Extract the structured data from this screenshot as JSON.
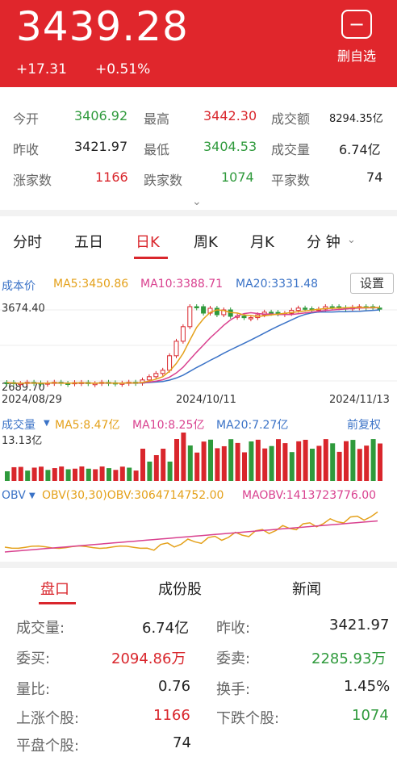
{
  "header": {
    "price": "3439.28",
    "change": "+17.31",
    "change_pct": "+0.51%",
    "remove_label": "删自选",
    "remove_icon_glyph": "−"
  },
  "stats": {
    "open_label": "今开",
    "open": "3406.92",
    "high_label": "最高",
    "high": "3442.30",
    "turnover_label": "成交额",
    "turnover": "8294.35亿",
    "prev_close_label": "昨收",
    "prev_close": "3421.97",
    "low_label": "最低",
    "low": "3404.53",
    "volume_label": "成交量",
    "volume": "6.74亿",
    "up_label": "涨家数",
    "up": "1166",
    "down_label": "跌家数",
    "down": "1074",
    "flat_label": "平家数",
    "flat": "74",
    "expand_glyph": "⌄"
  },
  "period_tabs": [
    "分时",
    "五日",
    "日K",
    "周K",
    "月K",
    "分 钟"
  ],
  "period_active": 2,
  "price_chart": {
    "cost_label": "成本价",
    "ma5": "MA5:3450.86",
    "ma10": "MA10:3388.71",
    "ma20": "MA20:3331.48",
    "settings": "设置",
    "y_max": "3674.40",
    "y_min": "2689.70",
    "dates": [
      "2024/08/29",
      "2024/10/11",
      "2024/11/13"
    ]
  },
  "volume_chart": {
    "label": "成交量",
    "ma5": "MA5:8.47亿",
    "ma10": "MA10:8.25亿",
    "ma20": "MA20:7.27亿",
    "adjust": "前复权",
    "y_max": "13.13亿"
  },
  "obv_chart": {
    "label": "OBV",
    "obv": "OBV(30,30)OBV:3064714752.00",
    "maobv": "MAOBV:1413723776.00"
  },
  "bottom_tabs": [
    "盘口",
    "成份股",
    "新闻"
  ],
  "bottom_active": 0,
  "details": {
    "volume_label": "成交量:",
    "volume": "6.74亿",
    "prev_close_label": "昨收:",
    "prev_close": "3421.97",
    "bid_label": "委买:",
    "bid": "2094.86万",
    "ask_label": "委卖:",
    "ask": "2285.93万",
    "ratio_label": "量比:",
    "ratio": "0.76",
    "turnover_rate_label": "换手:",
    "turnover_rate": "1.45%",
    "up_label": "上涨个股:",
    "up": "1166",
    "down_label": "下跌个股:",
    "down": "1074",
    "flat_label": "平盘个股:",
    "flat": "74"
  },
  "colors": {
    "header_red": "#e0262c",
    "up_red": "#d9262c",
    "down_green": "#2f9a3c",
    "ma5": "#e4a11b",
    "ma10": "#d9418f",
    "ma20": "#3b73c7"
  }
}
